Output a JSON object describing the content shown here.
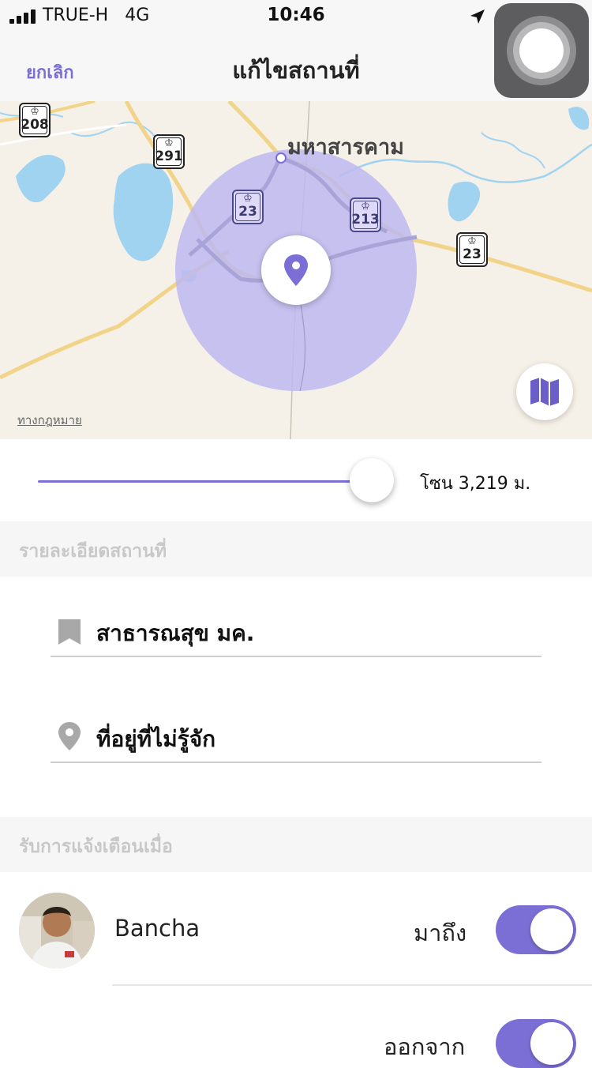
{
  "status_bar": {
    "carrier": "TRUE-H",
    "network": "4G",
    "time": "10:46",
    "signal_icon": "cellular-signal-icon",
    "location_icon": "location-arrow-icon"
  },
  "nav": {
    "cancel_label": "ยกเลิก",
    "title": "แก้ไขสถานที่"
  },
  "map": {
    "city_label": "มหาสารคาม",
    "legal_label": "ทางกฎหมาย",
    "route_shields": [
      "208",
      "291",
      "23",
      "213",
      "23"
    ],
    "pin_icon": "location-pin-icon",
    "map_type_icon": "map-fold-icon"
  },
  "radius": {
    "label": "โซน 3,219 ม.",
    "value_fraction": 0.95
  },
  "details": {
    "header": "รายละเอียดสถานที่",
    "name_value": "สาธารณสุข มค.",
    "address_value": "ที่อยู่ที่ไม่รู้จัก"
  },
  "notify": {
    "header": "รับการแจ้งเตือนเมื่อ",
    "user_name": "Bancha",
    "arrive_label": "มาถึง",
    "arrive_on": true,
    "leave_label": "ออกจาก",
    "leave_on": true
  },
  "colors": {
    "accent": "#7b6fd6",
    "zone_fill": "#bdb9f0",
    "header_text": "#c8c8c8"
  }
}
